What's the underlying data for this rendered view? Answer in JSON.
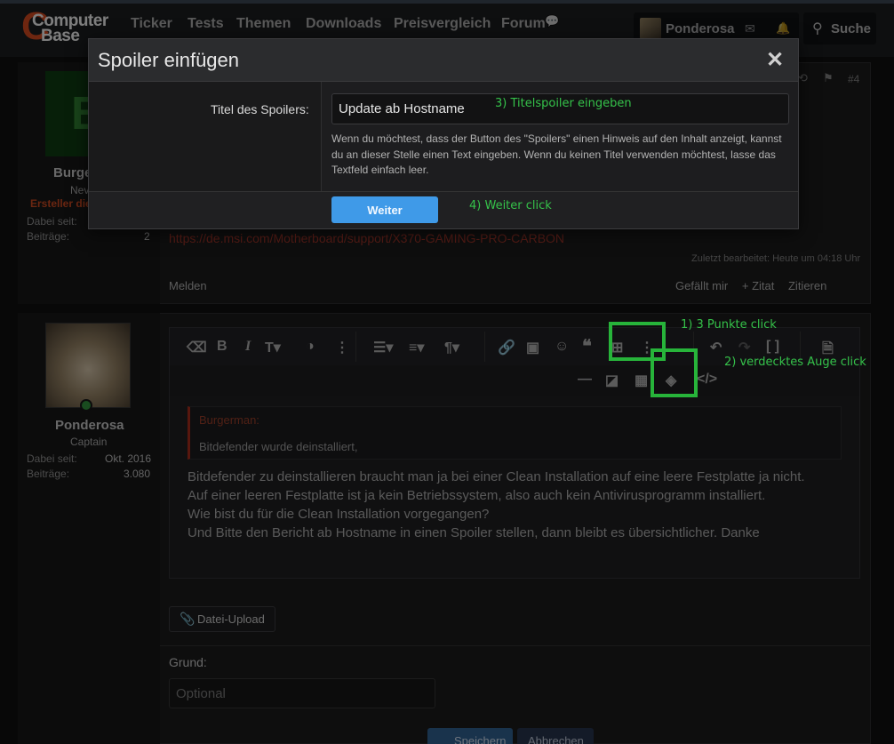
{
  "header": {
    "logo_line1": "Computer",
    "logo_line2": "Base",
    "logo_mark": "C",
    "nav": [
      "Ticker",
      "Tests",
      "Themen",
      "Downloads",
      "Preisvergleich",
      "Forum"
    ],
    "user_name": "Ponderosa",
    "search_label": "Suche",
    "icons": [
      "chat-bubbles-icon",
      "mail-icon",
      "bell-icon",
      "search-icon"
    ]
  },
  "post1": {
    "avatar_letter": "B",
    "user_name": "Burge",
    "user_title": "Nev",
    "user_role": "Ersteller die",
    "meta": [
      {
        "label": "Dabei seit:",
        "value": ""
      },
      {
        "label": "Beiträge:",
        "value": "2"
      }
    ],
    "post_number": "#4",
    "link": "https://de.msi.com/Motherboard/support/X370-GAMING-PRO-CARBON",
    "edited": "Zuletzt bearbeitet: Heute um 04:18 Uhr",
    "report": "Melden",
    "actions": [
      "Gefällt mir",
      "+ Zitat",
      "Zitieren"
    ]
  },
  "post2": {
    "user_name": "Ponderosa",
    "user_title": "Captain",
    "meta": [
      {
        "label": "Dabei seit:",
        "value": "Okt. 2016"
      },
      {
        "label": "Beiträge:",
        "value": "3.080"
      }
    ],
    "quote_author": "Burgerman:",
    "quote_text": "Bitdefender wurde deinstalliert,",
    "body": [
      "Bitdefender zu deinstallieren braucht man ja bei einer Clean Installation auf eine leere Festplatte ja nicht.",
      "Auf einer leeren Festplatte ist ja kein Betriebssystem, also auch kein Antivirusprogramm installiert.",
      "Wie bist du für die Clean Installation vorgegangen?",
      "Und Bitte den Bericht ab Hostname in einen Spoiler stellen, dann bleibt es übersichtlicher. Danke"
    ],
    "upload_label": "Datei-Upload",
    "reason_label": "Grund:",
    "reason_placeholder": "Optional",
    "save_label": "Speichern",
    "cancel_label": "Abbrechen"
  },
  "dialog": {
    "title": "Spoiler einfügen",
    "close": "✕",
    "field_label": "Titel des Spoilers:",
    "field_value": "Update ab Hostname",
    "hint": "Wenn du möchtest, dass der Button des \"Spoilers\" einen Hinweis auf den Inhalt anzeigt, kannst du an dieser Stelle einen Text eingeben. Wenn du keinen Titel verwenden möchtest, lasse das Textfeld einfach leer.",
    "continue_label": "Weiter"
  },
  "annotations": {
    "step1": "1) 3 Punkte click",
    "step2": "2) verdecktes Auge click",
    "step3": "3) Titelspoiler eingeben",
    "step4": "4) Weiter click",
    "color": "#27b43a"
  },
  "colors": {
    "accent": "#3f9ae8",
    "brand": "#c8461e",
    "link": "#c43a2b"
  }
}
